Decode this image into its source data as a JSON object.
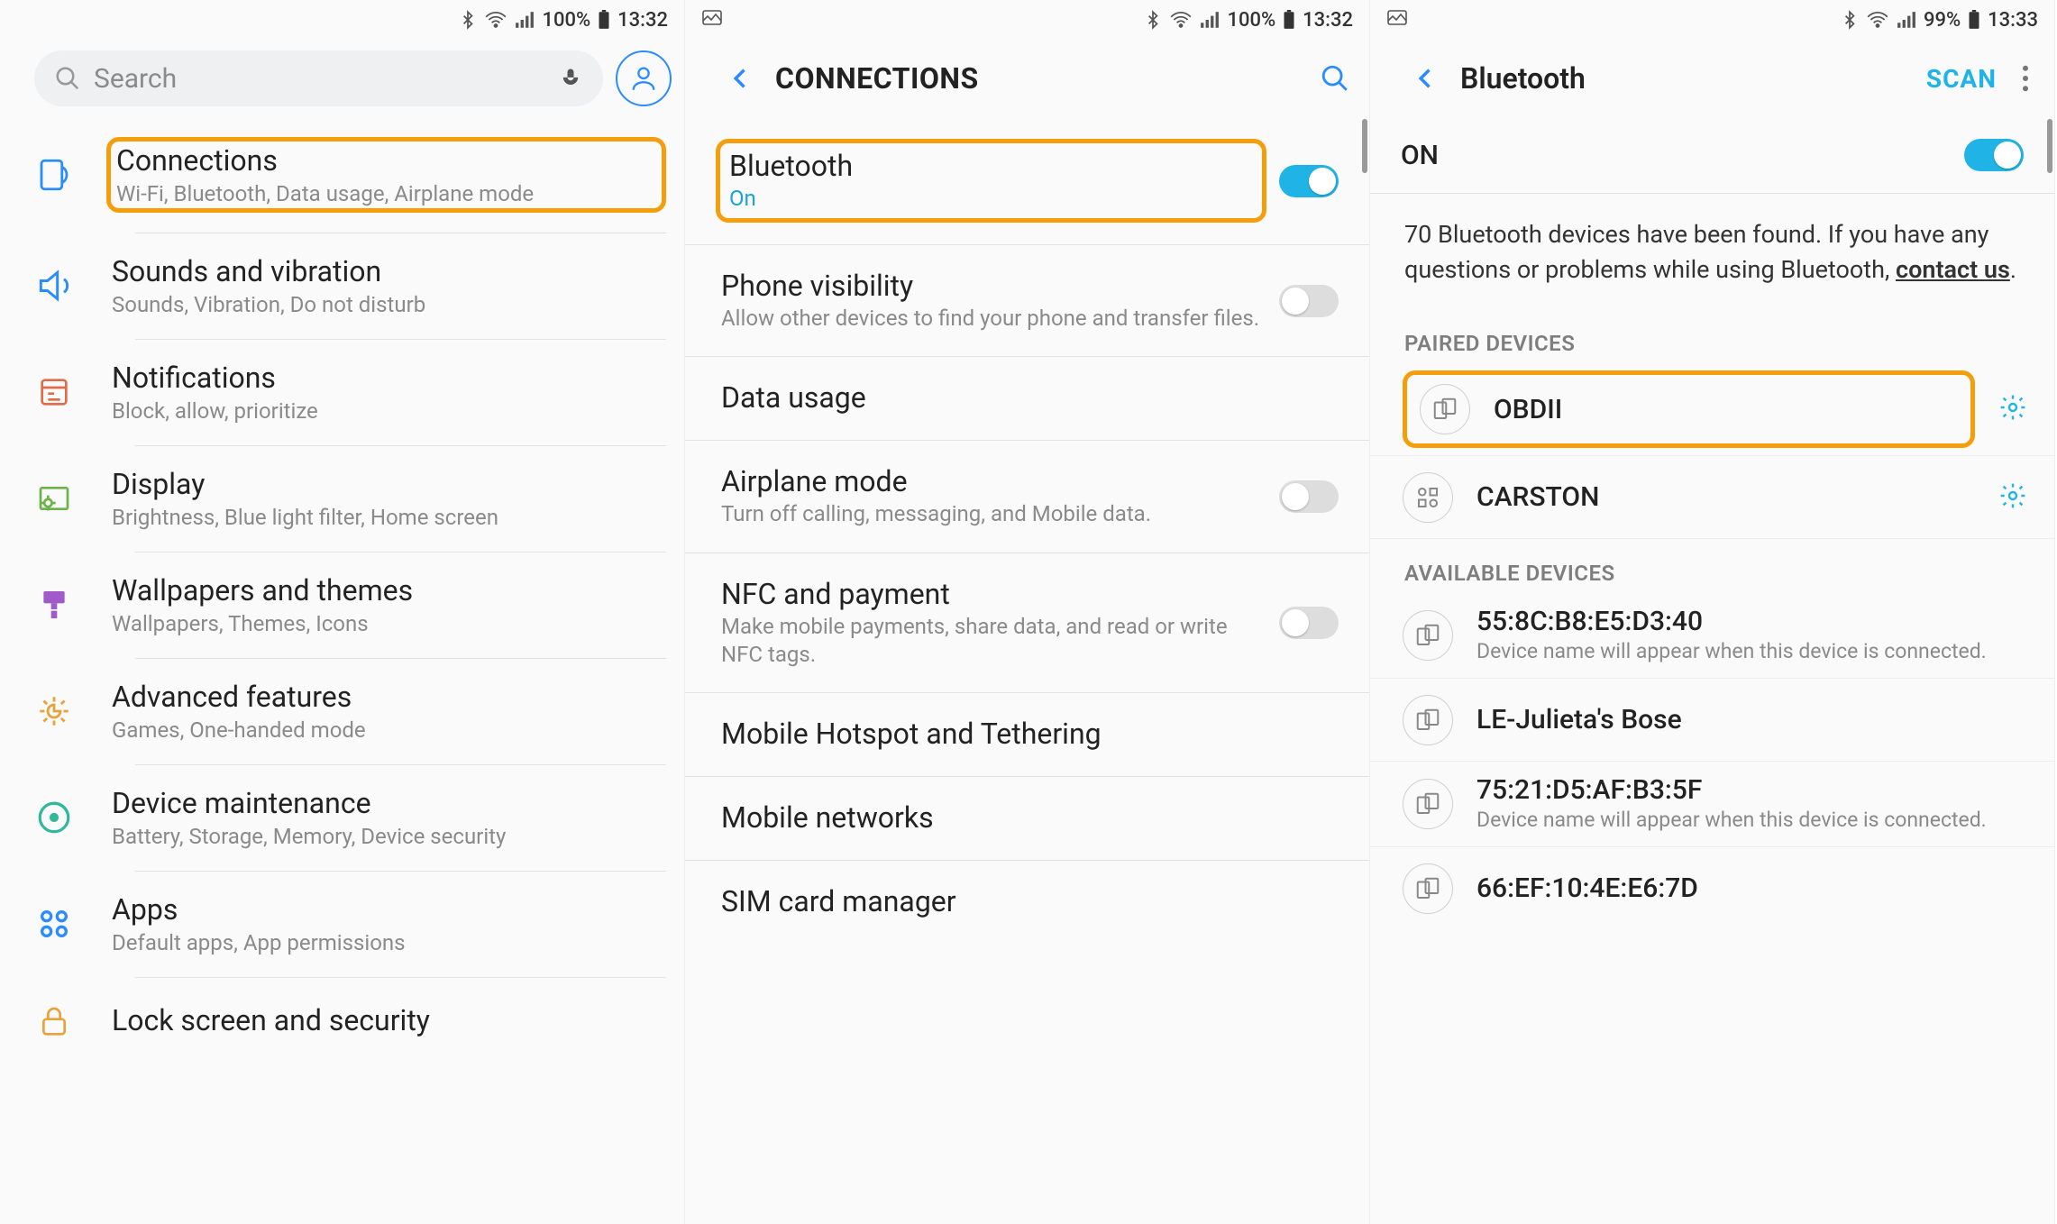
{
  "screen1": {
    "status": {
      "battery": "100%",
      "time": "13:32"
    },
    "search_placeholder": "Search",
    "items": [
      {
        "title": "Connections",
        "sub": "Wi-Fi, Bluetooth, Data usage, Airplane mode"
      },
      {
        "title": "Sounds and vibration",
        "sub": "Sounds, Vibration, Do not disturb"
      },
      {
        "title": "Notifications",
        "sub": "Block, allow, prioritize"
      },
      {
        "title": "Display",
        "sub": "Brightness, Blue light filter, Home screen"
      },
      {
        "title": "Wallpapers and themes",
        "sub": "Wallpapers, Themes, Icons"
      },
      {
        "title": "Advanced features",
        "sub": "Games, One-handed mode"
      },
      {
        "title": "Device maintenance",
        "sub": "Battery, Storage, Memory, Device security"
      },
      {
        "title": "Apps",
        "sub": "Default apps, App permissions"
      },
      {
        "title": "Lock screen and security",
        "sub": ""
      }
    ]
  },
  "screen2": {
    "status": {
      "battery": "100%",
      "time": "13:32"
    },
    "title": "CONNECTIONS",
    "rows": [
      {
        "title": "Bluetooth",
        "sub": "On"
      },
      {
        "title": "Phone visibility",
        "sub": "Allow other devices to find your phone and transfer files."
      },
      {
        "title": "Data usage",
        "sub": ""
      },
      {
        "title": "Airplane mode",
        "sub": "Turn off calling, messaging, and Mobile data."
      },
      {
        "title": "NFC and payment",
        "sub": "Make mobile payments, share data, and read or write NFC tags."
      },
      {
        "title": "Mobile Hotspot and Tethering",
        "sub": ""
      },
      {
        "title": "Mobile networks",
        "sub": ""
      },
      {
        "title": "SIM card manager",
        "sub": ""
      }
    ]
  },
  "screen3": {
    "status": {
      "battery": "99%",
      "time": "13:33"
    },
    "title": "Bluetooth",
    "scan": "SCAN",
    "on_label": "ON",
    "info_a": "70 Bluetooth devices have been found. If you have any questions or problems while using Bluetooth, ",
    "info_link": "contact us",
    "info_b": ".",
    "paired_header": "PAIRED DEVICES",
    "paired": [
      {
        "name": "OBDII"
      },
      {
        "name": "CARSTON"
      }
    ],
    "available_header": "AVAILABLE DEVICES",
    "available": [
      {
        "name": "55:8C:B8:E5:D3:40",
        "sub": "Device name will appear when this device is connected."
      },
      {
        "name": "LE-Julieta's Bose",
        "sub": ""
      },
      {
        "name": "75:21:D5:AF:B3:5F",
        "sub": "Device name will appear when this device is connected."
      },
      {
        "name": "66:EF:10:4E:E6:7D",
        "sub": ""
      }
    ]
  }
}
